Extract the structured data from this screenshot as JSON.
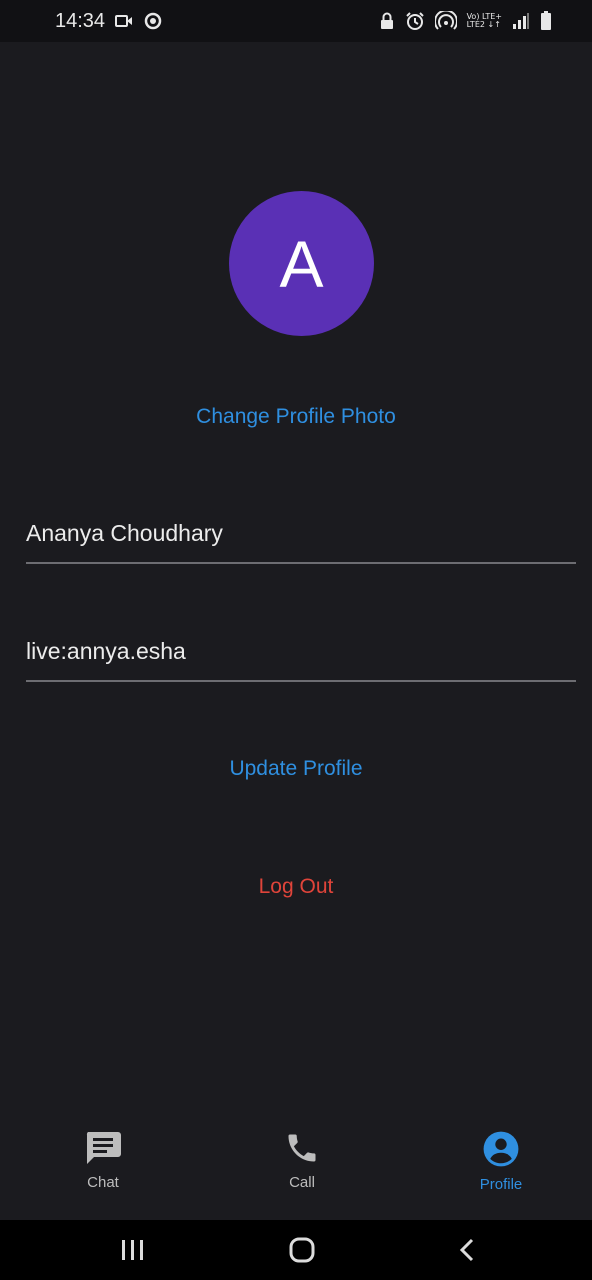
{
  "status_bar": {
    "time": "14:34",
    "network_top": "Vo) LTE+",
    "network_bottom": "LTE2 ↓↑",
    "icons": [
      "video-camera-icon",
      "data-saver-icon",
      "lock-icon",
      "alarm-icon",
      "hotspot-icon",
      "signal-icon",
      "battery-icon"
    ]
  },
  "profile": {
    "avatar_letter": "A",
    "avatar_color": "#5a30b5",
    "change_photo_label": "Change Profile Photo",
    "name_value": "Ananya Choudhary",
    "id_value": "live:annya.esha",
    "update_label": "Update Profile",
    "logout_label": "Log Out"
  },
  "bottom_nav": {
    "items": [
      {
        "label": "Chat",
        "icon": "chat-icon",
        "active": false
      },
      {
        "label": "Call",
        "icon": "phone-icon",
        "active": false
      },
      {
        "label": "Profile",
        "icon": "account-circle-icon",
        "active": true
      }
    ]
  },
  "colors": {
    "background": "#1b1b1f",
    "accent": "#2f8fe0",
    "danger": "#e0443a",
    "text": "#ececec"
  }
}
